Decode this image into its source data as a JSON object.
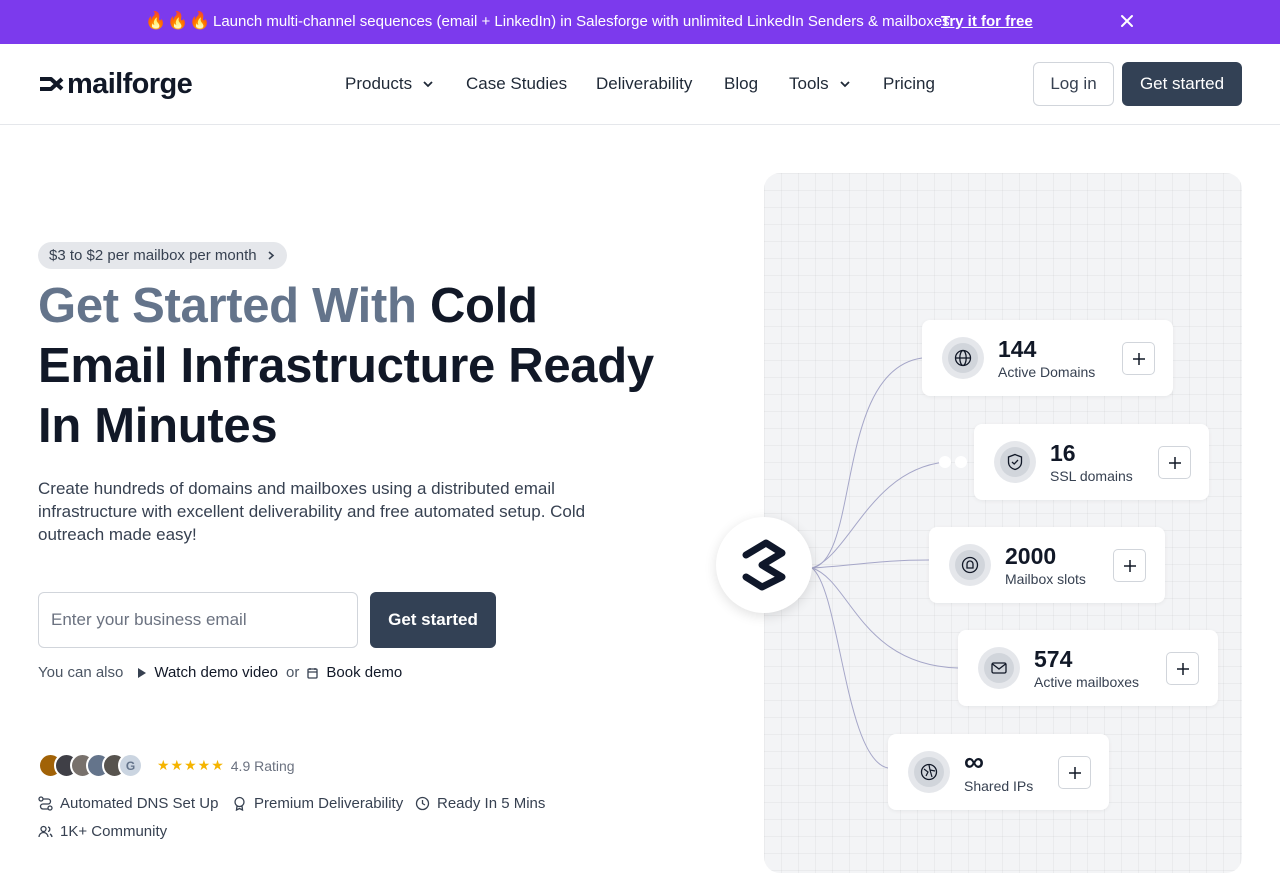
{
  "announcement": {
    "emoji": "🔥🔥🔥",
    "message": "Launch multi-channel sequences (email + LinkedIn) in Salesforge with unlimited LinkedIn Senders & mailboxes",
    "cta": "Try it for free"
  },
  "nav": {
    "logo": "mailforge",
    "items": [
      {
        "label": "Products",
        "has_dropdown": true
      },
      {
        "label": "Case Studies"
      },
      {
        "label": "Deliverability"
      },
      {
        "label": "Blog"
      },
      {
        "label": "Tools",
        "has_dropdown": true
      },
      {
        "label": "Pricing"
      }
    ],
    "login": "Log in",
    "get_started": "Get started"
  },
  "hero": {
    "pill": "$3 to $2 per mailbox per month",
    "headline_muted": "Get Started With",
    "headline_rest": " Cold Email Infrastructure Ready In Minutes",
    "subtext": "Create hundreds of domains and mailboxes using a distributed email infrastructure with excellent deliverability and free automated setup. Cold outreach made easy!",
    "email_placeholder": "Enter your business email",
    "email_value": "",
    "cta": "Get started",
    "also_prefix": "You can also",
    "watch_demo": "Watch demo video",
    "or": "or",
    "book_demo": "Book demo",
    "rating_stars": "★★★★★",
    "rating_text": "4.9 Rating",
    "features": [
      "Automated DNS Set Up",
      "Premium Deliverability",
      "Ready In 5 Mins",
      "1K+ Community"
    ]
  },
  "stats": [
    {
      "value": "144",
      "label": "Active Domains",
      "icon": "globe-icon"
    },
    {
      "value": "16",
      "label": "SSL domains",
      "icon": "shield-check-icon"
    },
    {
      "value": "2000",
      "label": "Mailbox slots",
      "icon": "mailbox-slot-icon"
    },
    {
      "value": "574",
      "label": "Active mailboxes",
      "icon": "mail-icon"
    },
    {
      "value": "∞",
      "label": "Shared IPs",
      "icon": "shared-ip-icon"
    }
  ],
  "colors": {
    "announce_bg": "#7c3aed",
    "primary_button": "#334155",
    "headline_muted": "#64748b",
    "star": "#f5b400"
  }
}
